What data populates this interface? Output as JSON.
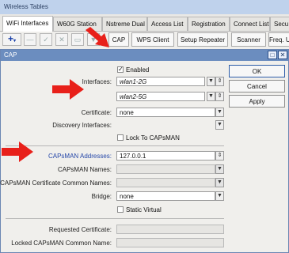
{
  "window_title": "Wireless Tables",
  "tabs": [
    {
      "label": "WiFi Interfaces",
      "active": true
    },
    {
      "label": "W60G Station"
    },
    {
      "label": "Nstreme Dual"
    },
    {
      "label": "Access List"
    },
    {
      "label": "Registration"
    },
    {
      "label": "Connect List"
    },
    {
      "label": "Secu"
    }
  ],
  "toolbar": {
    "add_icon": "+",
    "buttons": [
      "CAP",
      "WPS Client",
      "Setup Repeater",
      "Scanner",
      "Freq. U"
    ]
  },
  "dialog": {
    "title": "CAP",
    "restore_icon": "□",
    "close_icon": "✕",
    "enabled_label": "Enabled",
    "enabled_checked": true,
    "interfaces_label": "Interfaces:",
    "interface_values": [
      "wlan1-2G",
      "wlan2-5G"
    ],
    "certificate_label": "Certificate:",
    "certificate_value": "none",
    "discovery_label": "Discovery Interfaces:",
    "lock_label": "Lock To CAPsMAN",
    "capsman_addresses_label": "CAPsMAN Addresses:",
    "capsman_addresses_value": "127.0.0.1",
    "capsman_names_label": "CAPsMAN Names:",
    "capsman_cert_label": "CAPsMAN Certificate Common Names:",
    "bridge_label": "Bridge:",
    "bridge_value": "none",
    "static_virtual_label": "Static Virtual",
    "requested_cert_label": "Requested Certificate:",
    "locked_capsman_label": "Locked CAPsMAN Common Name:",
    "ok": "OK",
    "cancel": "Cancel",
    "apply": "Apply"
  },
  "colors": {
    "arrow": "#e8201a",
    "title_bar": "#6b8dbf",
    "link_label": "#2446a8"
  }
}
